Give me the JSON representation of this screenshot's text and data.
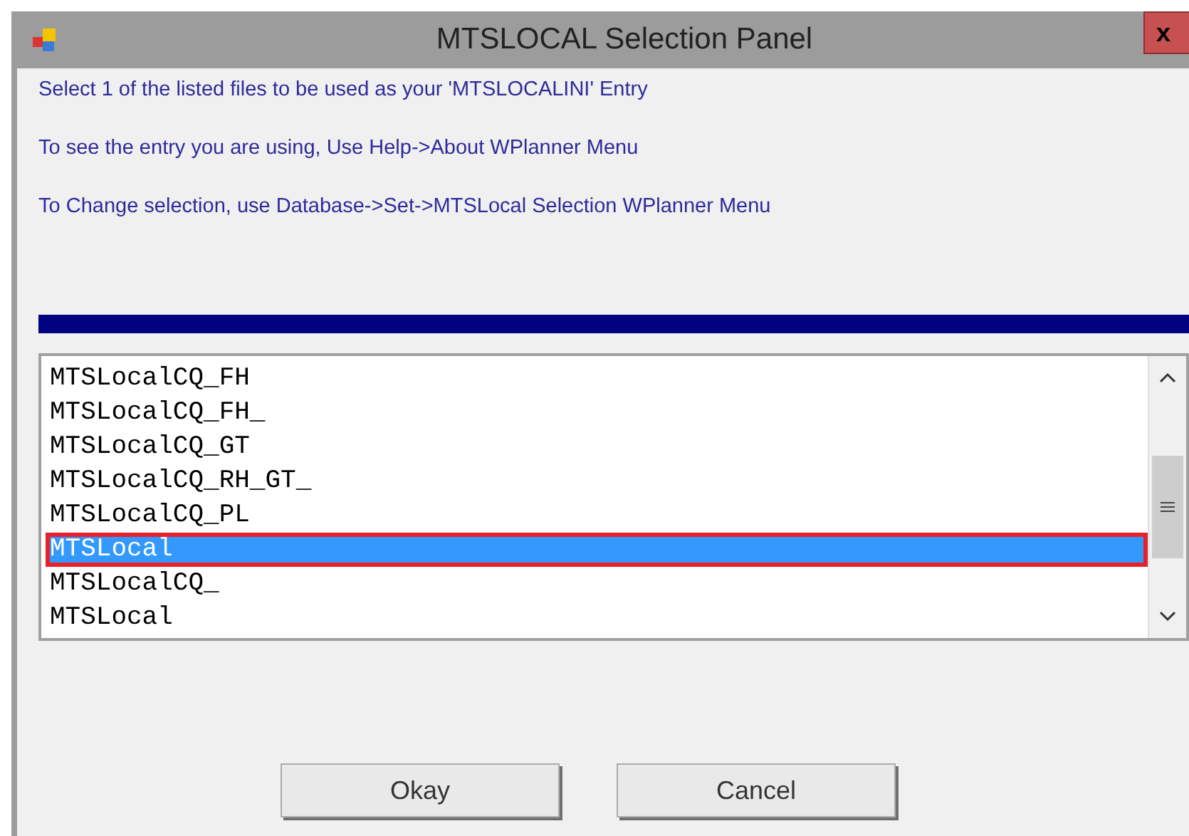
{
  "window": {
    "title": "MTSLOCAL Selection Panel",
    "close": "x"
  },
  "instructions": [
    "Select 1 of the listed files to be used as your 'MTSLOCALINI' Entry",
    "To see the entry you are using, Use Help->About WPlanner Menu",
    "To Change selection, use Database->Set->MTSLocal Selection WPlanner Menu"
  ],
  "progress": {
    "level": 1
  },
  "files": [
    {
      "label": "MTSLocalCQ_FH",
      "selected": false
    },
    {
      "label": "MTSLocalCQ_FH_",
      "selected": false
    },
    {
      "label": "MTSLocalCQ_GT",
      "selected": false
    },
    {
      "label": "MTSLocalCQ_RH_GT_",
      "selected": false
    },
    {
      "label": "MTSLocalCQ_PL",
      "selected": false
    },
    {
      "label": "MTSLocal",
      "selected": true
    },
    {
      "label": "MTSLocalCQ_",
      "selected": false
    },
    {
      "label": "MTSLocal",
      "selected": false
    }
  ],
  "buttons": [
    "Okay",
    "Cancel"
  ]
}
